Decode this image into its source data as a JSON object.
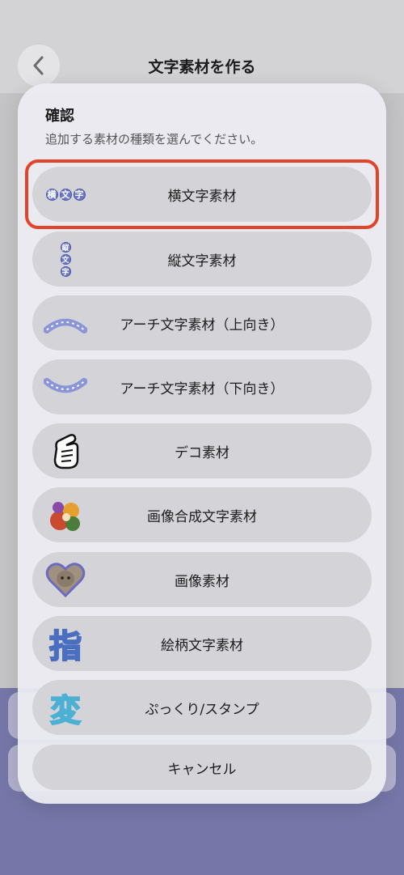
{
  "header": {
    "title": "文字素材を作る"
  },
  "sheet": {
    "title": "確認",
    "subtitle": "追加する素材の種類を選んでください。",
    "options": [
      {
        "label": "横文字素材",
        "icon": "horizontal-text-sample-icon",
        "icon_text": "横文字"
      },
      {
        "label": "縦文字素材",
        "icon": "vertical-text-sample-icon",
        "icon_text": "縦文字"
      },
      {
        "label": "アーチ文字素材（上向き）",
        "icon": "arch-up-text-sample-icon",
        "icon_text": "アーチ文字"
      },
      {
        "label": "アーチ文字素材（下向き）",
        "icon": "arch-down-text-sample-icon",
        "icon_text": "アーチ文字"
      },
      {
        "label": "デコ素材",
        "icon": "finger-heart-hand-icon"
      },
      {
        "label": "画像合成文字素材",
        "icon": "image-composite-letter-icon"
      },
      {
        "label": "画像素材",
        "icon": "heart-cat-photo-icon"
      },
      {
        "label": "絵柄文字素材",
        "icon": "patterned-letter-icon",
        "icon_text": "指"
      },
      {
        "label": "ぷっくり/スタンプ",
        "icon": "puffy-letter-icon",
        "icon_text": "変"
      },
      {
        "label": "キャンセル"
      }
    ]
  },
  "colors": {
    "highlight": "#e2442a",
    "accent": "#6b78c9",
    "bottom_bg": "#7676a8"
  }
}
